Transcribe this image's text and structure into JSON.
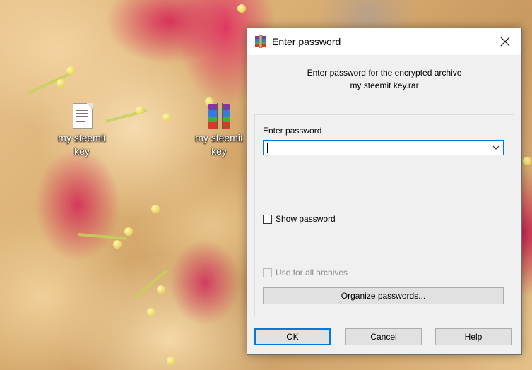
{
  "desktop": {
    "icons": [
      {
        "label": "my steemit key",
        "icon": "text-file-icon"
      },
      {
        "label": "my steemit key",
        "icon": "winrar-archive-icon"
      }
    ]
  },
  "dialog": {
    "title": "Enter password",
    "close_glyph": "✕",
    "info_line1": "Enter password for the encrypted archive",
    "info_line2": "my steemit key.rar",
    "password_label": "Enter password",
    "password_value": "",
    "show_password_label": "Show password",
    "show_password_checked": false,
    "use_for_all_label": "Use for all archives",
    "use_for_all_enabled": false,
    "organize_button": "Organize passwords...",
    "ok_button": "OK",
    "cancel_button": "Cancel",
    "help_button": "Help"
  },
  "colors": {
    "accent": "#0078d7",
    "dialog_bg": "#f0f0f0",
    "button_bg": "#e1e1e1"
  }
}
